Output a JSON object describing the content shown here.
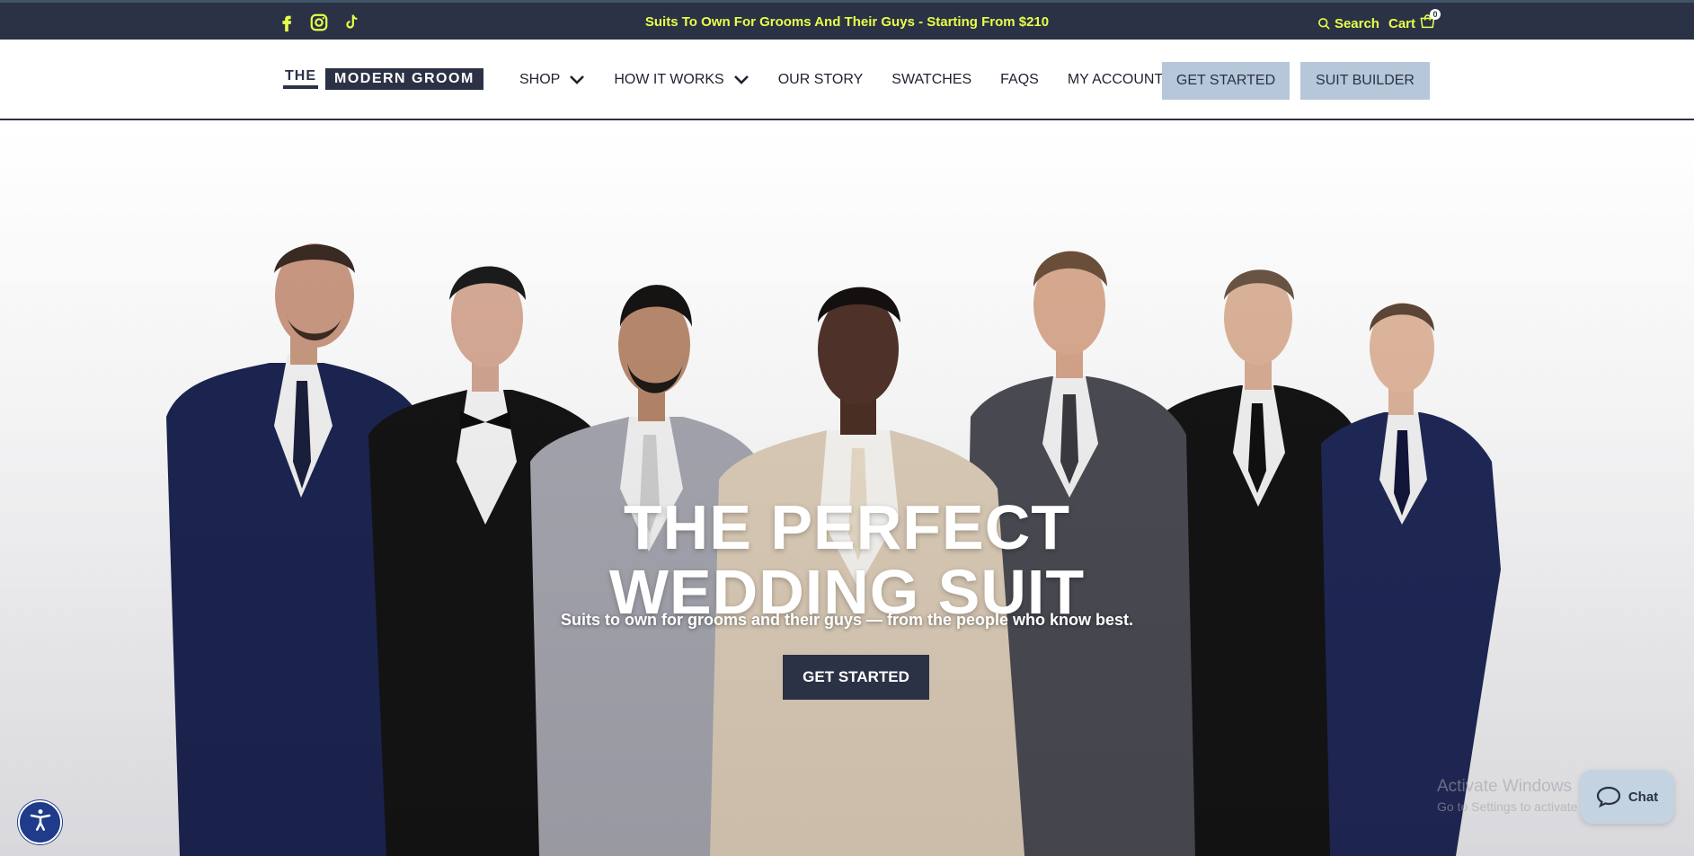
{
  "topbar": {
    "promo": "Suits To Own For Grooms And Their Guys - Starting From $210",
    "search_label": "Search",
    "cart_label": "Cart",
    "cart_count": "0",
    "social": [
      "facebook-icon",
      "instagram-icon",
      "tiktok-icon"
    ]
  },
  "nav": {
    "logo_the": "THE",
    "logo_main": "MODERN GROOM",
    "items": [
      {
        "label": "SHOP",
        "dropdown": true
      },
      {
        "label": "HOW IT WORKS",
        "dropdown": true
      },
      {
        "label": "OUR STORY",
        "dropdown": false
      },
      {
        "label": "SWATCHES",
        "dropdown": false
      },
      {
        "label": "FAQS",
        "dropdown": false
      },
      {
        "label": "MY ACCOUNT",
        "dropdown": true
      }
    ],
    "get_started": "GET STARTED",
    "suit_builder": "SUIT BUILDER"
  },
  "hero": {
    "title_line1": "THE PERFECT",
    "title_line2": "WEDDING SUIT",
    "subtitle": "Suits to own for grooms and their guys — from the people who know best.",
    "cta": "GET STARTED"
  },
  "overlay": {
    "windows_title": "Activate Windows",
    "windows_sub": "Go to Settings to activate Windows.",
    "chat_label": "Chat"
  },
  "colors": {
    "navy": "#2b3245",
    "accent": "#e6ff4a",
    "button_light": "#b6c7d9"
  }
}
